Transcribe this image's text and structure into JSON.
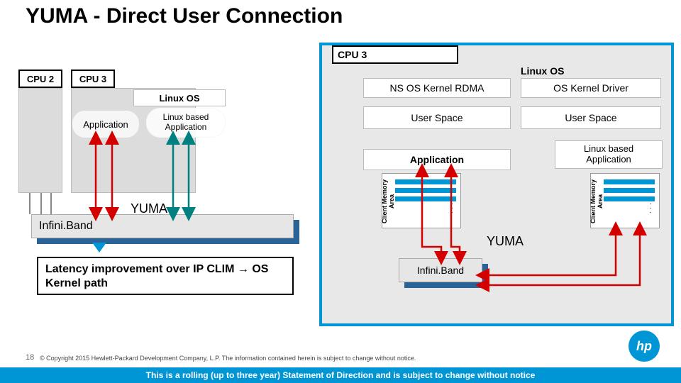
{
  "title": "YUMA - Direct User Connection",
  "left": {
    "cpu2": "CPU 2",
    "cpu3": "CPU 3",
    "linux_os": "Linux OS",
    "application": "Application",
    "linux_based_application": "Linux based\nApplication",
    "yuma": "YUMA",
    "infiniband": "Infini.Band"
  },
  "right": {
    "cpu3": "CPU 3",
    "linux_os": "Linux OS",
    "ns_os_kernel_rdma": "NS OS Kernel RDMA",
    "os_kernel_driver": "OS Kernel Driver",
    "user_space_l": "User Space",
    "user_space_r": "User Space",
    "application": "Application",
    "linux_based_application": "Linux based\nApplication",
    "client_memory_area": "Client Memory Area",
    "yuma": "YUMA",
    "infiniband": "Infini.Band"
  },
  "callout": "Latency improvement over IP CLIM → OS Kernel path",
  "footer": {
    "page": "18",
    "copyright": "© Copyright 2015 Hewlett-Packard Development Company, L.P.  The information contained herein is subject to change without notice.",
    "rolling": "This is a rolling (up to three year) Statement of Direction and is subject to change without notice",
    "logo": "hp"
  }
}
